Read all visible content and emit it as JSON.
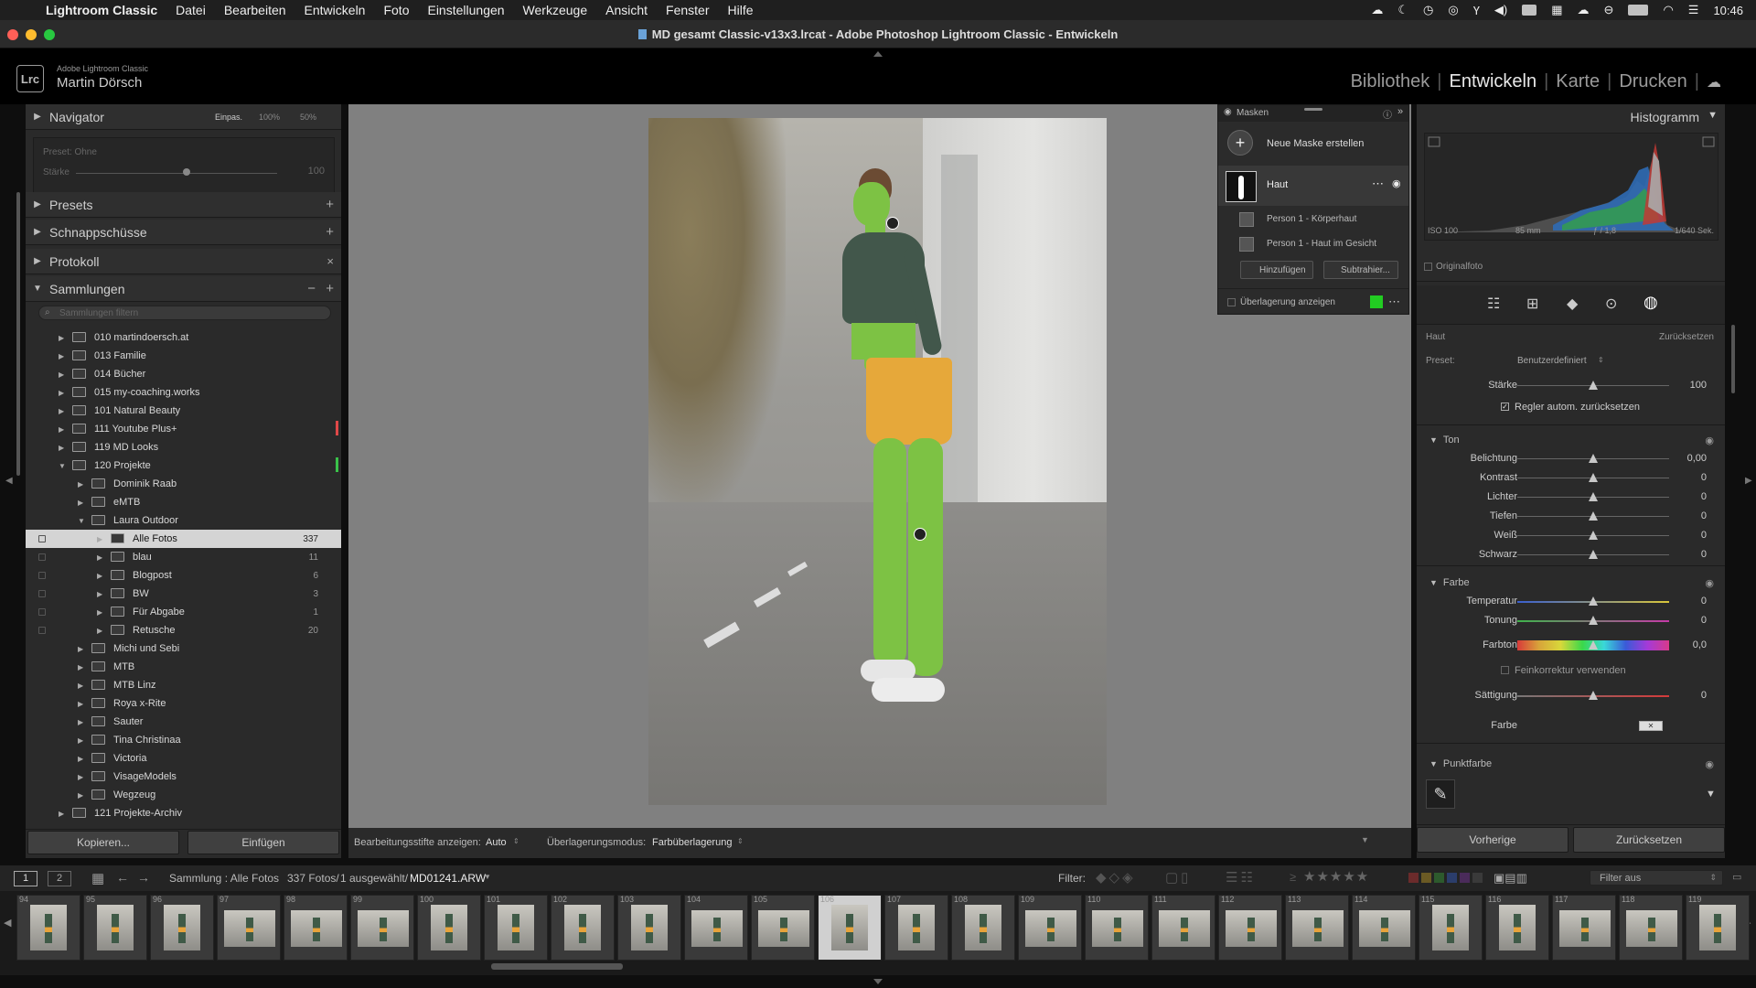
{
  "menubar": {
    "app": "Lightroom Classic",
    "items": [
      "Datei",
      "Bearbeiten",
      "Entwickeln",
      "Foto",
      "Einstellungen",
      "Werkzeuge",
      "Ansicht",
      "Fenster",
      "Hilfe"
    ],
    "clock": "10:46"
  },
  "window": {
    "title": "MD gesamt Classic-v13x3.lrcat - Adobe Photoshop Lightroom Classic - Entwickeln"
  },
  "identity": {
    "logo": "Lrc",
    "product": "Adobe Lightroom Classic",
    "user": "Martin Dörsch"
  },
  "modules": [
    "Bibliothek",
    "Entwickeln",
    "Karte",
    "Drucken"
  ],
  "active_module": "Entwickeln",
  "left": {
    "navigator": {
      "label": "Navigator",
      "zoom_fit": "Einpas.",
      "zoom_100": "100%",
      "zoom_50": "50%"
    },
    "preset_box": {
      "preset": "Preset: Ohne",
      "strength_label": "Stärke",
      "strength_value": "100"
    },
    "presets": "Presets",
    "snapshots": "Schnappschüsse",
    "history": "Protokoll",
    "collections": "Sammlungen",
    "search_placeholder": "Sammlungen filtern",
    "tree": [
      {
        "label": "010 martindoersch.at",
        "level": 0,
        "exp": "▶"
      },
      {
        "label": "013 Familie",
        "level": 0,
        "exp": "▶"
      },
      {
        "label": "014 Bücher",
        "level": 0,
        "exp": "▶"
      },
      {
        "label": "015 my-coaching.works",
        "level": 0,
        "exp": "▶"
      },
      {
        "label": "101 Natural Beauty",
        "level": 0,
        "exp": "▶"
      },
      {
        "label": "111 Youtube Plus+",
        "level": 0,
        "exp": "▶"
      },
      {
        "label": "119 MD Looks",
        "level": 0,
        "exp": "▶"
      },
      {
        "label": "120 Projekte",
        "level": 0,
        "exp": "▼"
      },
      {
        "label": "Dominik Raab",
        "level": 1,
        "exp": "▶"
      },
      {
        "label": "eMTB",
        "level": 1,
        "exp": "▶"
      },
      {
        "label": "Laura Outdoor",
        "level": 1,
        "exp": "▼"
      },
      {
        "label": "Alle Fotos",
        "level": 2,
        "exp": "▶",
        "count": "337",
        "selected": true
      },
      {
        "label": "blau",
        "level": 2,
        "exp": "▶",
        "count": "11"
      },
      {
        "label": "Blogpost",
        "level": 2,
        "exp": "▶",
        "count": "6"
      },
      {
        "label": "BW",
        "level": 2,
        "exp": "▶",
        "count": "3"
      },
      {
        "label": "Für Abgabe",
        "level": 2,
        "exp": "▶",
        "count": "1"
      },
      {
        "label": "Retusche",
        "level": 2,
        "exp": "▶",
        "count": "20"
      },
      {
        "label": "Michi und Sebi",
        "level": 1,
        "exp": "▶"
      },
      {
        "label": "MTB",
        "level": 1,
        "exp": "▶"
      },
      {
        "label": "MTB Linz",
        "level": 1,
        "exp": "▶"
      },
      {
        "label": "Roya x-Rite",
        "level": 1,
        "exp": "▶"
      },
      {
        "label": "Sauter",
        "level": 1,
        "exp": "▶"
      },
      {
        "label": "Tina Christinaa",
        "level": 1,
        "exp": "▶"
      },
      {
        "label": "Victoria",
        "level": 1,
        "exp": "▶"
      },
      {
        "label": "VisageModels",
        "level": 1,
        "exp": "▶"
      },
      {
        "label": "Wegzeug",
        "level": 1,
        "exp": "▶"
      },
      {
        "label": "121 Projekte-Archiv",
        "level": 0,
        "exp": "▶"
      }
    ],
    "copy_button": "Kopieren...",
    "paste_button": "Einfügen"
  },
  "toolstrip": {
    "pins_label": "Bearbeitungsstifte anzeigen:",
    "pins_value": "Auto",
    "overlay_label": "Überlagerungsmodus:",
    "overlay_value": "Farbüberlagerung"
  },
  "masks": {
    "title": "Masken",
    "create": "Neue Maske erstellen",
    "mask_name": "Haut",
    "components": [
      "Person 1 - Körperhaut",
      "Person 1 - Haut im Gesicht"
    ],
    "add": "Hinzufügen",
    "subtract": "Subtrahier...",
    "overlay": "Überlagerung anzeigen",
    "overlay_color": "#22cc22"
  },
  "histogram": {
    "title": "Histogramm",
    "iso": "ISO 100",
    "focal": "85 mm",
    "aperture": "ƒ / 1,8",
    "shutter": "1/640 Sek.",
    "original": "Originalfoto"
  },
  "mask_settings": {
    "name": "Haut",
    "reset": "Zurücksetzen",
    "preset_label": "Preset:",
    "preset_value": "Benutzerdefiniert",
    "strength_label": "Stärke",
    "strength_value": "100",
    "strength_fraction": 1.0,
    "auto_reset": "Regler autom. zurücksetzen"
  },
  "tone": {
    "title": "Ton",
    "sliders": [
      {
        "name": "Belichtung",
        "value": "0,00"
      },
      {
        "name": "Kontrast",
        "value": "0"
      },
      {
        "name": "Lichter",
        "value": "0"
      },
      {
        "name": "Tiefen",
        "value": "0"
      },
      {
        "name": "Weiß",
        "value": "0"
      },
      {
        "name": "Schwarz",
        "value": "0"
      }
    ]
  },
  "color": {
    "title": "Farbe",
    "sliders": [
      {
        "name": "Temperatur",
        "value": "0"
      },
      {
        "name": "Tonung",
        "value": "0"
      },
      {
        "name": "Farbton",
        "value": "0,0"
      }
    ],
    "fine": "Feinkorrektur verwenden",
    "saturation": {
      "name": "Sättigung",
      "value": "0"
    },
    "color_label": "Farbe"
  },
  "point_color": {
    "title": "Punktfarbe"
  },
  "right_buttons": {
    "prev": "Vorherige",
    "reset": "Zurücksetzen"
  },
  "filmbar": {
    "view1": "1",
    "view2": "2",
    "source": "Sammlung : Alle Fotos",
    "count": "337 Fotos/",
    "selected": "1 ausgewählt/",
    "file": "MD01241.ARW",
    "filter_label": "Filter:",
    "filter_value": "Filter aus"
  },
  "filmstrip": [
    {
      "num": "94",
      "land": false
    },
    {
      "num": "95",
      "land": false
    },
    {
      "num": "96",
      "land": false
    },
    {
      "num": "97",
      "land": true
    },
    {
      "num": "98",
      "land": true
    },
    {
      "num": "99",
      "land": true
    },
    {
      "num": "100",
      "land": false
    },
    {
      "num": "101",
      "land": false
    },
    {
      "num": "102",
      "land": false
    },
    {
      "num": "103",
      "land": false
    },
    {
      "num": "104",
      "land": true
    },
    {
      "num": "105",
      "land": true
    },
    {
      "num": "106",
      "land": false,
      "selected": true
    },
    {
      "num": "107",
      "land": false
    },
    {
      "num": "108",
      "land": false
    },
    {
      "num": "109",
      "land": true
    },
    {
      "num": "110",
      "land": true
    },
    {
      "num": "111",
      "land": true
    },
    {
      "num": "112",
      "land": true
    },
    {
      "num": "113",
      "land": true
    },
    {
      "num": "114",
      "land": true
    },
    {
      "num": "115",
      "land": false
    },
    {
      "num": "116",
      "land": false
    },
    {
      "num": "117",
      "land": true
    },
    {
      "num": "118",
      "land": true
    },
    {
      "num": "119",
      "land": false
    }
  ]
}
